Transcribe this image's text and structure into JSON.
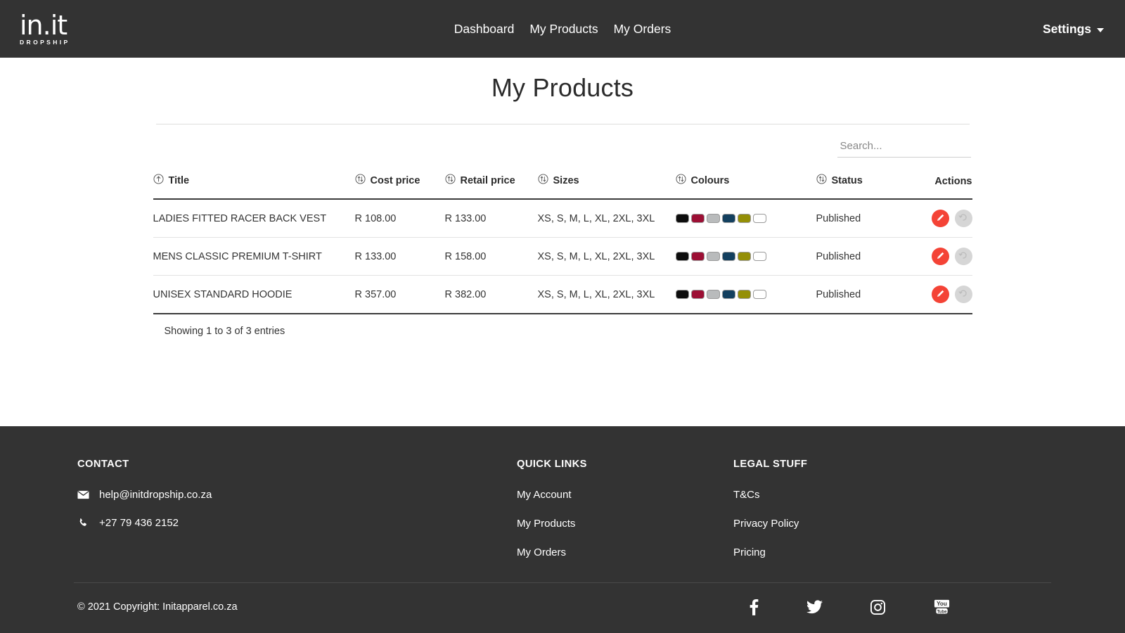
{
  "navbar": {
    "brand": {
      "main": "in.it",
      "sub": "DROPSHIP"
    },
    "links": [
      {
        "label": "Dashboard",
        "name": "nav-link-dashboard"
      },
      {
        "label": "My Products",
        "name": "nav-link-my-products"
      },
      {
        "label": "My Orders",
        "name": "nav-link-my-orders"
      }
    ],
    "settings_label": "Settings"
  },
  "main": {
    "page_title": "My Products",
    "search": {
      "placeholder": "Search...",
      "value": ""
    },
    "columns": [
      {
        "label": "Title",
        "sort": "asc"
      },
      {
        "label": "Cost price",
        "sort": "none"
      },
      {
        "label": "Retail price",
        "sort": "none"
      },
      {
        "label": "Sizes",
        "sort": "none"
      },
      {
        "label": "Colours",
        "sort": "none"
      },
      {
        "label": "Status",
        "sort": "none"
      },
      {
        "label": "Actions",
        "sort": "none"
      }
    ],
    "rows": [
      {
        "title": "LADIES FITTED RACER BACK VEST",
        "cost_price": "R 108.00",
        "retail_price": "R 133.00",
        "sizes": "XS, S, M, L, XL, 2XL, 3XL",
        "colours": [
          "#0d0d0d",
          "#9c0f34",
          "#b9bbbc",
          "#13405f",
          "#948f07",
          "#ffffff"
        ],
        "status": "Published"
      },
      {
        "title": "MENS CLASSIC PREMIUM T-SHIRT",
        "cost_price": "R 133.00",
        "retail_price": "R 158.00",
        "sizes": "XS, S, M, L, XL, 2XL, 3XL",
        "colours": [
          "#0d0d0d",
          "#9c0f34",
          "#b9bbbc",
          "#13405f",
          "#948f07",
          "#ffffff"
        ],
        "status": "Published"
      },
      {
        "title": "UNISEX STANDARD HOODIE",
        "cost_price": "R 357.00",
        "retail_price": "R 382.00",
        "sizes": "XS, S, M, L, XL, 2XL, 3XL",
        "colours": [
          "#0d0d0d",
          "#9c0f34",
          "#b9bbbc",
          "#13405f",
          "#948f07",
          "#ffffff"
        ],
        "status": "Published"
      }
    ],
    "entries_info": "Showing 1 to 3 of 3 entries",
    "action_icons": {
      "edit": "pencil-icon",
      "revert": "undo-icon"
    },
    "accent_edit_color": "#f44336",
    "revert_color": "#d6d6d6"
  },
  "footer": {
    "contact": {
      "heading": "CONTACT",
      "email": "help@initdropship.co.za",
      "phone": "+27 79 436 2152"
    },
    "quick_links": {
      "heading": "QUICK LINKS",
      "items": [
        {
          "label": "My Account"
        },
        {
          "label": "My Products"
        },
        {
          "label": "My Orders"
        }
      ]
    },
    "legal": {
      "heading": "LEGAL STUFF",
      "items": [
        {
          "label": "T&Cs"
        },
        {
          "label": "Privacy Policy"
        },
        {
          "label": "Pricing"
        }
      ]
    },
    "copyright": "© 2021 Copyright: Initapparel.co.za",
    "socials": [
      {
        "name": "facebook-icon"
      },
      {
        "name": "twitter-icon"
      },
      {
        "name": "instagram-icon"
      },
      {
        "name": "youtube-icon"
      }
    ],
    "background_color": "#333333"
  }
}
